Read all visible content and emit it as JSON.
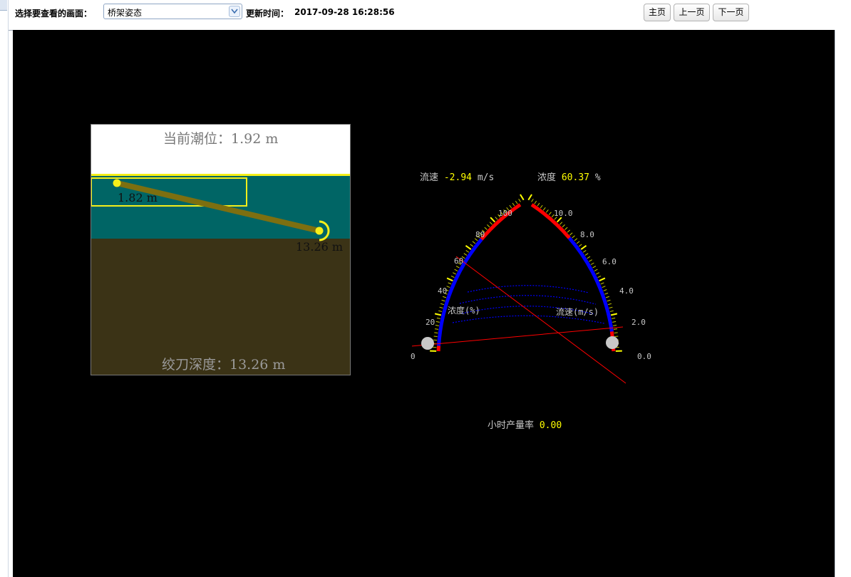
{
  "toolbar": {
    "select_label": "选择要查看的画面：",
    "select_value": "桥架姿态",
    "update_label": "更新时间：",
    "update_time": "2017-09-28 16:28:56",
    "buttons": {
      "home": "主页",
      "prev": "上一页",
      "next": "下一页"
    }
  },
  "bridge": {
    "tide_text": "当前潮位：1.92 m",
    "bridge_length_text": "1.82 m",
    "cutter_depth_label": "13.26 m",
    "cutter_depth_text": "绞刀深度：13.26 m"
  },
  "gauge": {
    "velocity_label": "流速",
    "velocity_value": "-2.94",
    "velocity_unit": "m/s",
    "density_label": "浓度",
    "density_value": "60.37",
    "density_unit": "%",
    "left_arc_label": "浓度(%)",
    "right_arc_label": "流速(m/s)",
    "left_ticks": [
      "0",
      "20",
      "40",
      "60",
      "80",
      "100"
    ],
    "right_ticks": [
      "0.0",
      "2.0",
      "4.0",
      "6.0",
      "8.0",
      "10.0"
    ],
    "hourly_label": "小时产量率",
    "hourly_value": "0.00",
    "colors": {
      "red": "#ff0000",
      "blue": "#0000ff",
      "yellow": "#ffff00",
      "needle": "#ff0000"
    }
  }
}
